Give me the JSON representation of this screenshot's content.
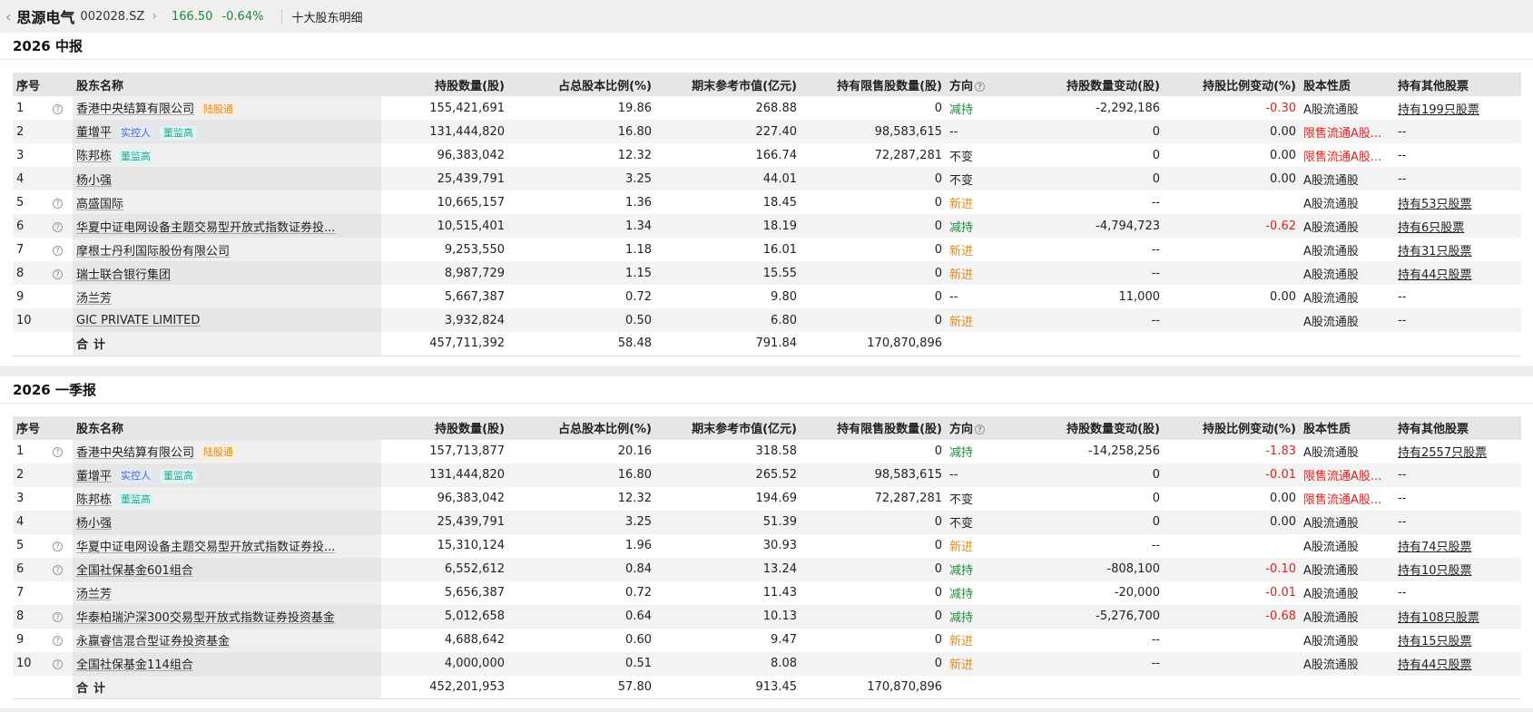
{
  "header": {
    "back_icon": "chevron-left-icon",
    "stock_name": "思源电气",
    "stock_code": "002028.SZ",
    "price": "166.50",
    "change_pct": "-0.64%",
    "page_name": "十大股东明细"
  },
  "columns": [
    "序号",
    "股东名称",
    "持股数量(股)",
    "占总股本比例(%)",
    "期末参考市值(亿元)",
    "持有限售股数量(股)",
    "方向",
    "持股数量变动(股)",
    "持股比例变动(%)",
    "股本性质",
    "持有其他股票"
  ],
  "sections": [
    {
      "title": "2026 中报",
      "rows": [
        {
          "idx": "1",
          "q": true,
          "name": "香港中央结算有限公司",
          "tags": [
            {
              "t": "陆股通",
              "c": "orange"
            }
          ],
          "shares": "155,421,691",
          "ratio": "19.86",
          "mv": "268.88",
          "restricted": "0",
          "dir": "减持",
          "dirc": "down",
          "chg": "-2,292,186",
          "chgpct": "-0.30",
          "chgpctc": "red",
          "nature": "A股流通股",
          "naturec": "",
          "other": "持有199只股票"
        },
        {
          "idx": "2",
          "q": false,
          "name": "董增平",
          "tags": [
            {
              "t": "实控人",
              "c": "blue"
            },
            {
              "t": "董监高",
              "c": "teal"
            }
          ],
          "shares": "131,444,820",
          "ratio": "16.80",
          "mv": "227.40",
          "restricted": "98,583,615",
          "dir": "--",
          "dirc": "same",
          "chg": "0",
          "chgpct": "0.00",
          "chgpctc": "",
          "nature": "限售流通A股...",
          "naturec": "red",
          "other": "--"
        },
        {
          "idx": "3",
          "q": false,
          "name": "陈邦栋",
          "tags": [
            {
              "t": "董监高",
              "c": "teal"
            }
          ],
          "shares": "96,383,042",
          "ratio": "12.32",
          "mv": "166.74",
          "restricted": "72,287,281",
          "dir": "不变",
          "dirc": "same",
          "chg": "0",
          "chgpct": "0.00",
          "chgpctc": "",
          "nature": "限售流通A股...",
          "naturec": "red",
          "other": "--"
        },
        {
          "idx": "4",
          "q": false,
          "name": "杨小强",
          "tags": [],
          "shares": "25,439,791",
          "ratio": "3.25",
          "mv": "44.01",
          "restricted": "0",
          "dir": "不变",
          "dirc": "same",
          "chg": "0",
          "chgpct": "0.00",
          "chgpctc": "",
          "nature": "A股流通股",
          "naturec": "",
          "other": "--"
        },
        {
          "idx": "5",
          "q": true,
          "name": "高盛国际",
          "tags": [],
          "shares": "10,665,157",
          "ratio": "1.36",
          "mv": "18.45",
          "restricted": "0",
          "dir": "新进",
          "dirc": "new",
          "chg": "--",
          "chgpct": "",
          "chgpctc": "",
          "nature": "A股流通股",
          "naturec": "",
          "other": "持有53只股票"
        },
        {
          "idx": "6",
          "q": true,
          "name": "华夏中证电网设备主题交易型开放式指数证券投...",
          "tags": [],
          "shares": "10,515,401",
          "ratio": "1.34",
          "mv": "18.19",
          "restricted": "0",
          "dir": "减持",
          "dirc": "down",
          "chg": "-4,794,723",
          "chgpct": "-0.62",
          "chgpctc": "red",
          "nature": "A股流通股",
          "naturec": "",
          "other": "持有6只股票"
        },
        {
          "idx": "7",
          "q": true,
          "name": "摩根士丹利国际股份有限公司",
          "tags": [],
          "shares": "9,253,550",
          "ratio": "1.18",
          "mv": "16.01",
          "restricted": "0",
          "dir": "新进",
          "dirc": "new",
          "chg": "--",
          "chgpct": "",
          "chgpctc": "",
          "nature": "A股流通股",
          "naturec": "",
          "other": "持有31只股票"
        },
        {
          "idx": "8",
          "q": true,
          "name": "瑞士联合银行集团",
          "tags": [],
          "shares": "8,987,729",
          "ratio": "1.15",
          "mv": "15.55",
          "restricted": "0",
          "dir": "新进",
          "dirc": "new",
          "chg": "--",
          "chgpct": "",
          "chgpctc": "",
          "nature": "A股流通股",
          "naturec": "",
          "other": "持有44只股票"
        },
        {
          "idx": "9",
          "q": false,
          "name": "汤兰芳",
          "tags": [],
          "shares": "5,667,387",
          "ratio": "0.72",
          "mv": "9.80",
          "restricted": "0",
          "dir": "--",
          "dirc": "same",
          "chg": "11,000",
          "chgpct": "0.00",
          "chgpctc": "",
          "nature": "A股流通股",
          "naturec": "",
          "other": "--"
        },
        {
          "idx": "10",
          "q": false,
          "name": "GIC PRIVATE LIMITED",
          "tags": [],
          "shares": "3,932,824",
          "ratio": "0.50",
          "mv": "6.80",
          "restricted": "0",
          "dir": "新进",
          "dirc": "new",
          "chg": "--",
          "chgpct": "",
          "chgpctc": "",
          "nature": "A股流通股",
          "naturec": "",
          "other": "--"
        }
      ],
      "total": {
        "label": "合计",
        "shares": "457,711,392",
        "ratio": "58.48",
        "mv": "791.84",
        "restricted": "170,870,896"
      }
    },
    {
      "title": "2026 一季报",
      "rows": [
        {
          "idx": "1",
          "q": true,
          "name": "香港中央结算有限公司",
          "tags": [
            {
              "t": "陆股通",
              "c": "orange"
            }
          ],
          "shares": "157,713,877",
          "ratio": "20.16",
          "mv": "318.58",
          "restricted": "0",
          "dir": "减持",
          "dirc": "down",
          "chg": "-14,258,256",
          "chgpct": "-1.83",
          "chgpctc": "red",
          "nature": "A股流通股",
          "naturec": "",
          "other": "持有2557只股票"
        },
        {
          "idx": "2",
          "q": false,
          "name": "董增平",
          "tags": [
            {
              "t": "实控人",
              "c": "blue"
            },
            {
              "t": "董监高",
              "c": "teal"
            }
          ],
          "shares": "131,444,820",
          "ratio": "16.80",
          "mv": "265.52",
          "restricted": "98,583,615",
          "dir": "--",
          "dirc": "same",
          "chg": "0",
          "chgpct": "-0.01",
          "chgpctc": "red",
          "nature": "限售流通A股...",
          "naturec": "red",
          "other": "--"
        },
        {
          "idx": "3",
          "q": false,
          "name": "陈邦栋",
          "tags": [
            {
              "t": "董监高",
              "c": "teal"
            }
          ],
          "shares": "96,383,042",
          "ratio": "12.32",
          "mv": "194.69",
          "restricted": "72,287,281",
          "dir": "不变",
          "dirc": "same",
          "chg": "0",
          "chgpct": "0.00",
          "chgpctc": "",
          "nature": "限售流通A股...",
          "naturec": "red",
          "other": "--"
        },
        {
          "idx": "4",
          "q": false,
          "name": "杨小强",
          "tags": [],
          "shares": "25,439,791",
          "ratio": "3.25",
          "mv": "51.39",
          "restricted": "0",
          "dir": "不变",
          "dirc": "same",
          "chg": "0",
          "chgpct": "0.00",
          "chgpctc": "",
          "nature": "A股流通股",
          "naturec": "",
          "other": "--"
        },
        {
          "idx": "5",
          "q": true,
          "name": "华夏中证电网设备主题交易型开放式指数证券投...",
          "tags": [],
          "shares": "15,310,124",
          "ratio": "1.96",
          "mv": "30.93",
          "restricted": "0",
          "dir": "新进",
          "dirc": "new",
          "chg": "--",
          "chgpct": "",
          "chgpctc": "",
          "nature": "A股流通股",
          "naturec": "",
          "other": "持有74只股票"
        },
        {
          "idx": "6",
          "q": true,
          "name": "全国社保基金601组合",
          "tags": [],
          "shares": "6,552,612",
          "ratio": "0.84",
          "mv": "13.24",
          "restricted": "0",
          "dir": "减持",
          "dirc": "down",
          "chg": "-808,100",
          "chgpct": "-0.10",
          "chgpctc": "red",
          "nature": "A股流通股",
          "naturec": "",
          "other": "持有10只股票"
        },
        {
          "idx": "7",
          "q": false,
          "name": "汤兰芳",
          "tags": [],
          "shares": "5,656,387",
          "ratio": "0.72",
          "mv": "11.43",
          "restricted": "0",
          "dir": "减持",
          "dirc": "down",
          "chg": "-20,000",
          "chgpct": "-0.01",
          "chgpctc": "red",
          "nature": "A股流通股",
          "naturec": "",
          "other": "--"
        },
        {
          "idx": "8",
          "q": true,
          "name": "华泰柏瑞沪深300交易型开放式指数证券投资基金",
          "tags": [],
          "shares": "5,012,658",
          "ratio": "0.64",
          "mv": "10.13",
          "restricted": "0",
          "dir": "减持",
          "dirc": "down",
          "chg": "-5,276,700",
          "chgpct": "-0.68",
          "chgpctc": "red",
          "nature": "A股流通股",
          "naturec": "",
          "other": "持有108只股票"
        },
        {
          "idx": "9",
          "q": true,
          "name": "永赢睿信混合型证券投资基金",
          "tags": [],
          "shares": "4,688,642",
          "ratio": "0.60",
          "mv": "9.47",
          "restricted": "0",
          "dir": "新进",
          "dirc": "new",
          "chg": "--",
          "chgpct": "",
          "chgpctc": "",
          "nature": "A股流通股",
          "naturec": "",
          "other": "持有15只股票"
        },
        {
          "idx": "10",
          "q": true,
          "name": "全国社保基金114组合",
          "tags": [],
          "shares": "4,000,000",
          "ratio": "0.51",
          "mv": "8.08",
          "restricted": "0",
          "dir": "新进",
          "dirc": "new",
          "chg": "--",
          "chgpct": "",
          "chgpctc": "",
          "nature": "A股流通股",
          "naturec": "",
          "other": "持有44只股票"
        }
      ],
      "total": {
        "label": "合计",
        "shares": "452,201,953",
        "ratio": "57.80",
        "mv": "913.45",
        "restricted": "170,870,896"
      }
    }
  ]
}
